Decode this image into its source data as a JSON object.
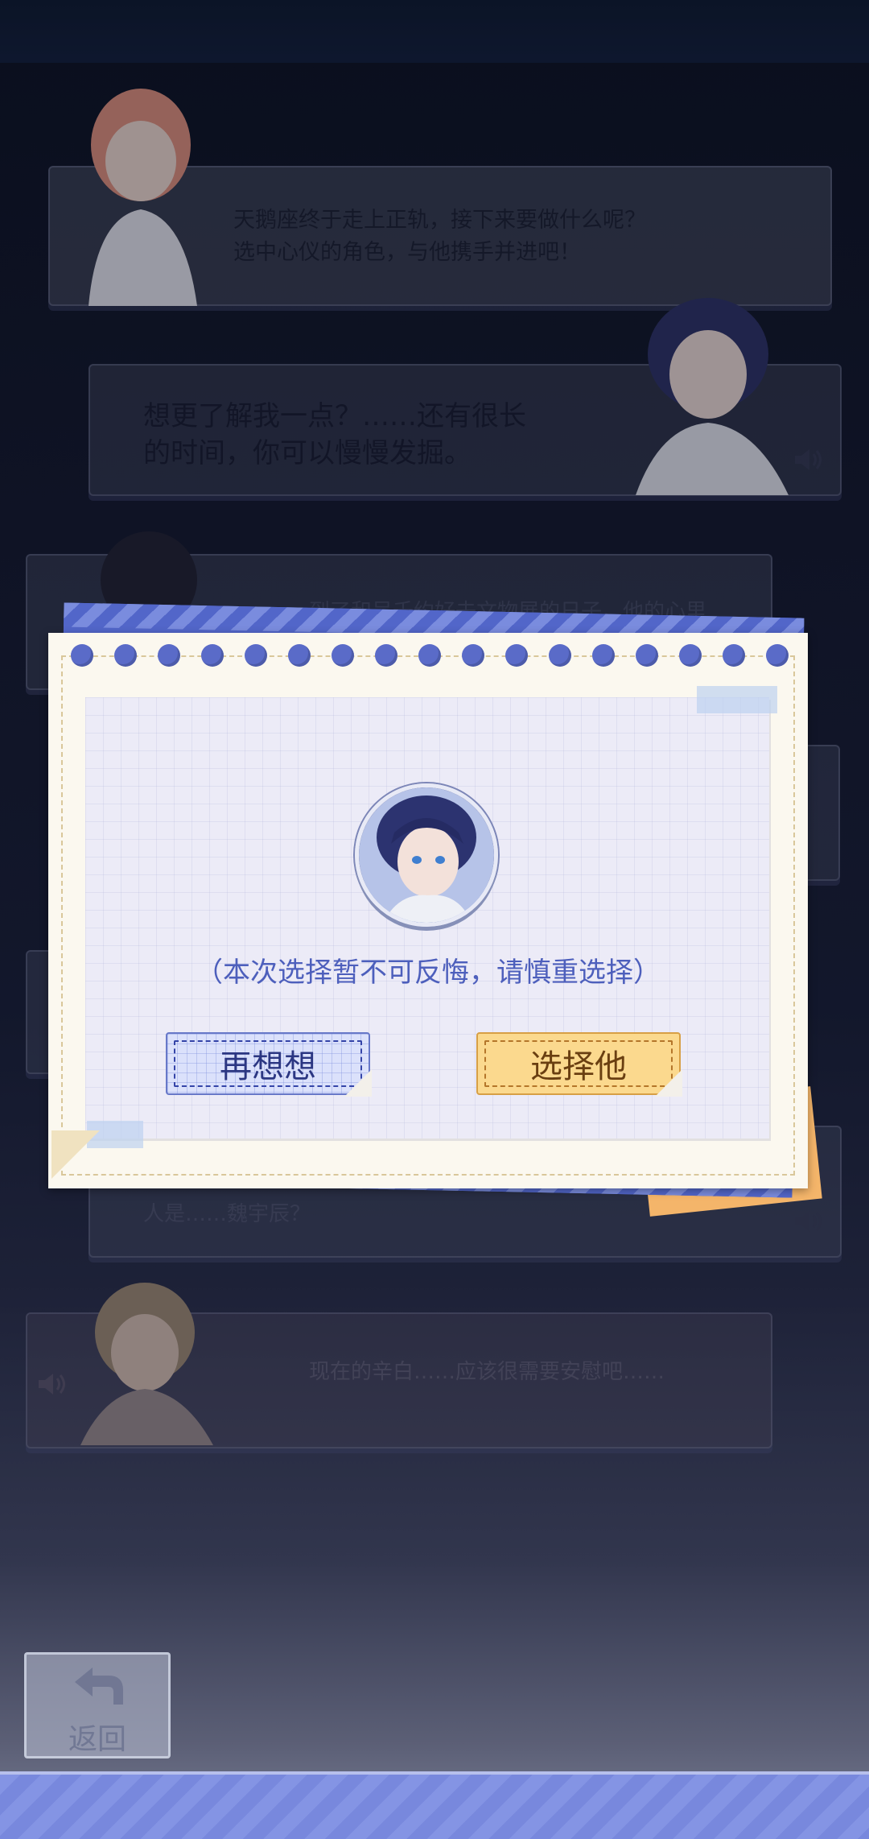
{
  "dialogue": [
    {
      "speaker": "female-guide",
      "text": "天鹅座终于走上正轨，接下来要做什么呢？\n选中心仪的角色，与他携手并进吧！"
    },
    {
      "speaker": "dark-haired-man",
      "text": "想更了解我一点？……还有很长\n的时间，你可以慢慢发掘。"
    },
    {
      "speaker": "long-haired-man",
      "text": "到了和吴千约好去文物展的日子。他的心里"
    },
    {
      "speaker": "unknown",
      "text": "人是……魏宇辰？"
    },
    {
      "speaker": "blond-man",
      "text": "现在的辛白……应该很需要安慰吧……"
    }
  ],
  "modal": {
    "warning": "（本次选择暂不可反悔，请慎重选择）",
    "cancel_label": "再想想",
    "confirm_label": "选择他",
    "avatar": "dark-haired-man-portrait"
  },
  "back_label": "返回",
  "colors": {
    "accent": "#4d5fbc",
    "confirm": "#fbd98e",
    "cancel": "#dbe1fb"
  }
}
